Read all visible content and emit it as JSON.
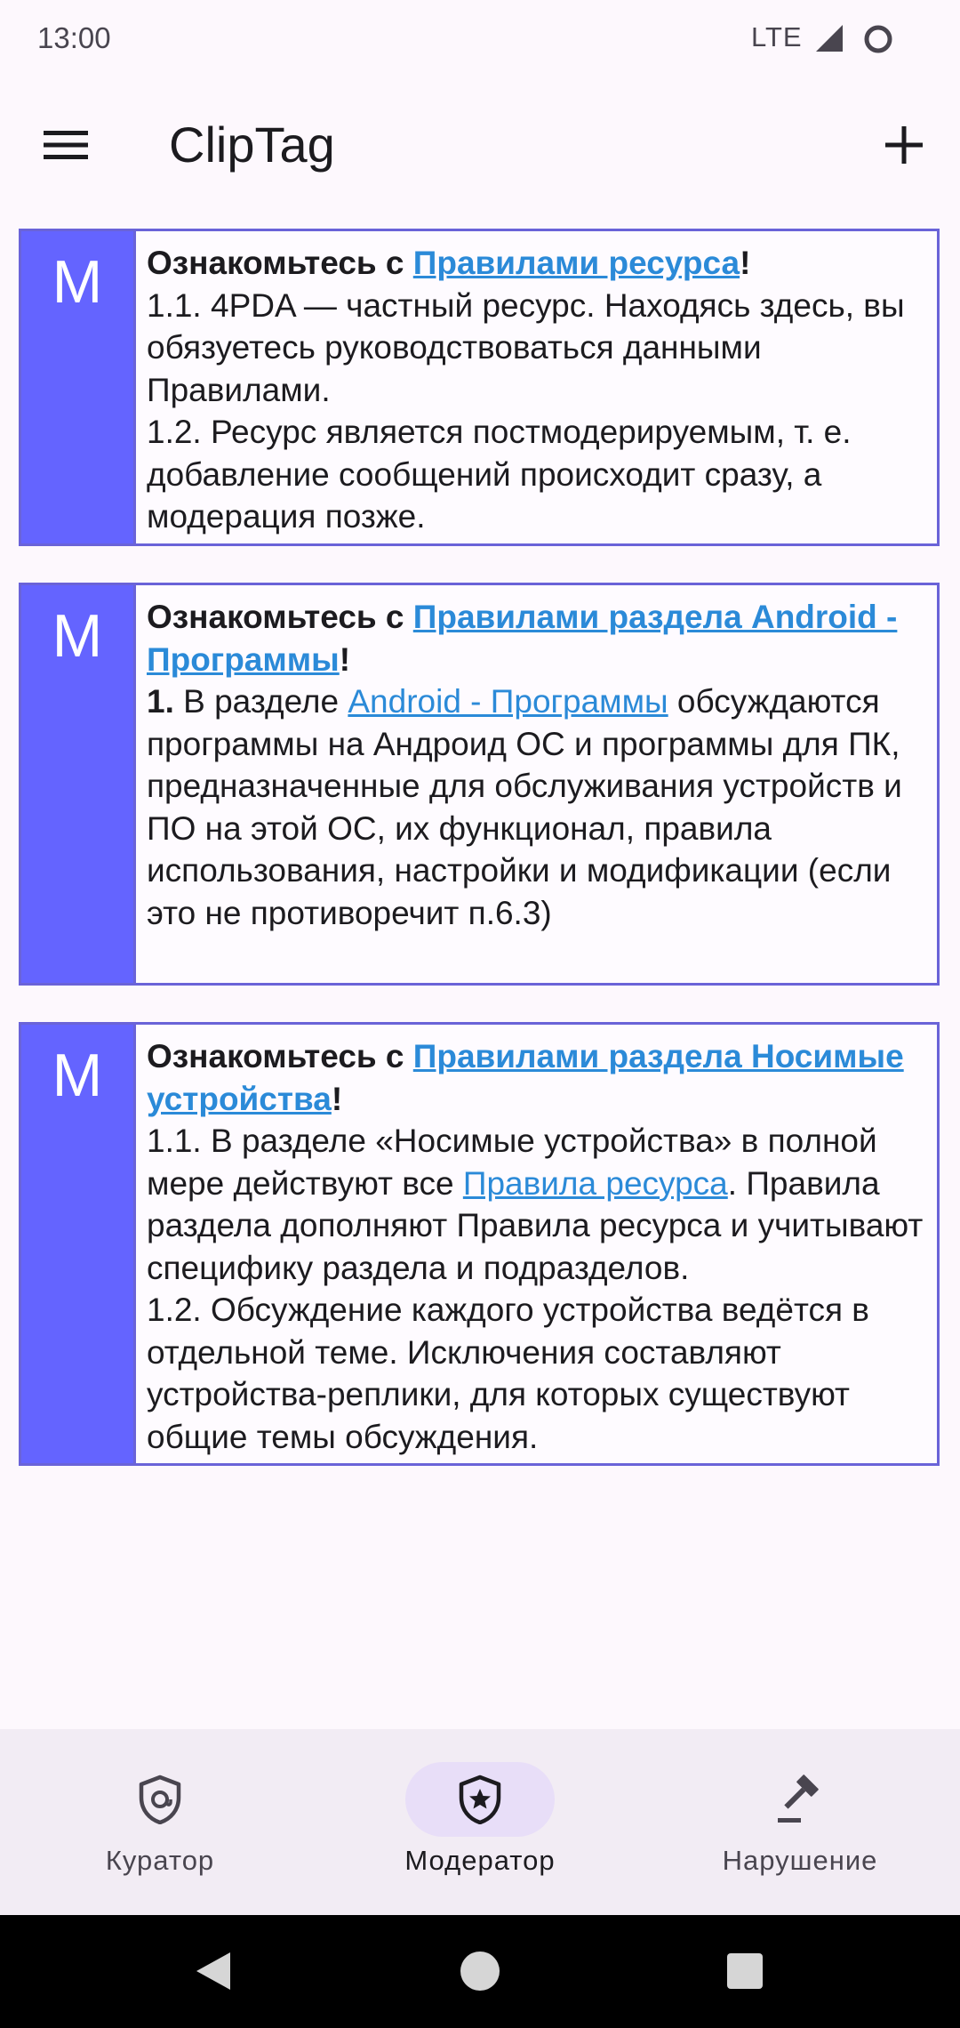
{
  "status_bar": {
    "time": "13:00",
    "network": "LTE",
    "signal_icon": "signal-icon",
    "battery_icon": "battery-icon"
  },
  "app_bar": {
    "title": "ClipTag",
    "menu_icon": "menu-icon",
    "add_icon": "add-icon"
  },
  "colors": {
    "badge": "#6464ff",
    "border": "#6a63d8",
    "link": "#2b8ad8",
    "nav_active": "#e8def8",
    "nav_bg": "#f2ecf4"
  },
  "cards": [
    {
      "badge": "M",
      "heading_prefix": "Ознакомьтесь с ",
      "heading_link": "Правилами ресурса",
      "heading_suffix": "!",
      "p1": "1.1. 4PDA — частный ресурс. Находясь здесь, вы обязуетесь руководствоваться данными Правилами.",
      "p2": "1.2. Ресурс является постмодерируемым, т. е. добавление сообщений происходит сразу, а модерация позже."
    },
    {
      "badge": "M",
      "heading_prefix": "Ознакомьтесь с ",
      "heading_link": "Правилами раздела Android - Программы",
      "heading_suffix": "!",
      "num": "1.",
      "text_a": " В разделе ",
      "link": "Android - Программы",
      "text_b": " обсуждаются программы на Андроид ОС и программы для ПК, предназначенные для обслуживания устройств и ПО на этой ОС, их функционал, правила использования, настройки и модификации (если это не противоречит п.6.3)"
    },
    {
      "badge": "M",
      "heading_prefix": "Ознакомьтесь с ",
      "heading_link": "Правилами раздела Носимые устройства",
      "heading_suffix": "!",
      "text_a": "1.1. В разделе «Носимые устройства» в полной мере действуют все ",
      "link": "Правила ресурса",
      "text_b": ". Правила раздела дополняют Правила ресурса и учитывают специфику раздела и подразделов.",
      "p2": "1.2. Обсуждение каждого устройства ведётся в отдельной теме. Исключения составляют устройства-реплики, для которых существуют общие темы обсуждения."
    }
  ],
  "bottom_nav": [
    {
      "label": "Куратор",
      "icon": "curator-shield-icon",
      "active": false
    },
    {
      "label": "Модератор",
      "icon": "moderator-star-shield-icon",
      "active": true
    },
    {
      "label": "Нарушение",
      "icon": "gavel-icon",
      "active": false
    }
  ],
  "system_nav": {
    "back_icon": "back-icon",
    "home_icon": "home-icon",
    "recents_icon": "recents-icon"
  }
}
